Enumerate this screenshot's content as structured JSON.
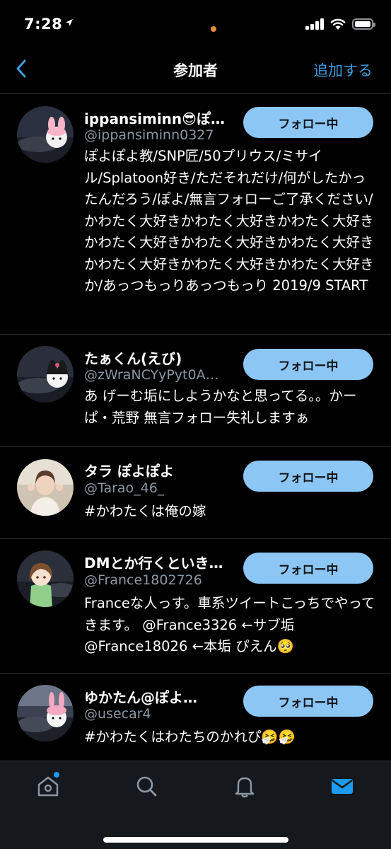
{
  "status_bar": {
    "time": "7:28"
  },
  "nav": {
    "title": "参加者",
    "add_label": "追加する"
  },
  "members": [
    {
      "name": "ippansiminn😎ぽ…",
      "handle": "@ippansiminn0327",
      "follow_label": "フォロー中",
      "bio": "ぽよぽよ教/SNP匠/50プリウス/ミサイル/Splatoon好き/ただそれだけ/何がしたかったんだろう/ぽよ/無言フォローご了承ください/かわたく大好きかわたく大好きかわたく大好きかわたく大好きかわたく大好きかわたく大好きかわたく大好きかわたく大好きかわたく大好きか/あっつもっりあっつもっり 2019/9 START"
    },
    {
      "name": "たぁくん(えび)",
      "handle": "@zWraNCYyPyt0A…",
      "follow_label": "フォロー中",
      "bio": "あ げーむ垢にしようかなと思ってる。。かーぱ・荒野 無言フォロー失礼しますぁ"
    },
    {
      "name": "タラ ぽよぽよ",
      "handle": "@Tarao_46_",
      "follow_label": "フォロー中",
      "bio": "#かわたくは俺の嫁"
    },
    {
      "name": "DMとか行くといき…",
      "handle": "@France1802726",
      "follow_label": "フォロー中",
      "bio": "Franceな人っす。車系ツイートこっちでやってきます。 @France3326 ←サブ垢 @France18026 ←本垢 ぴえん🥺"
    },
    {
      "name": "ゆかたん@ぽよ…",
      "handle": "@usecar4",
      "follow_label": "フォロー中",
      "bio": "#かわたくはわたちのかれぴ🤧🤧"
    }
  ],
  "tabs": [
    "home",
    "search",
    "notifications",
    "messages"
  ],
  "colors": {
    "accent": "#3f9bdb",
    "follow_button": "#8cc6f5",
    "handle": "#8b98a5",
    "tab_active": "#1d9bf0"
  },
  "icons": [
    "location-arrow-icon",
    "signal-icon",
    "wifi-icon",
    "battery-icon",
    "back-chevron-icon",
    "home-icon",
    "search-icon",
    "bell-icon",
    "mail-icon"
  ]
}
